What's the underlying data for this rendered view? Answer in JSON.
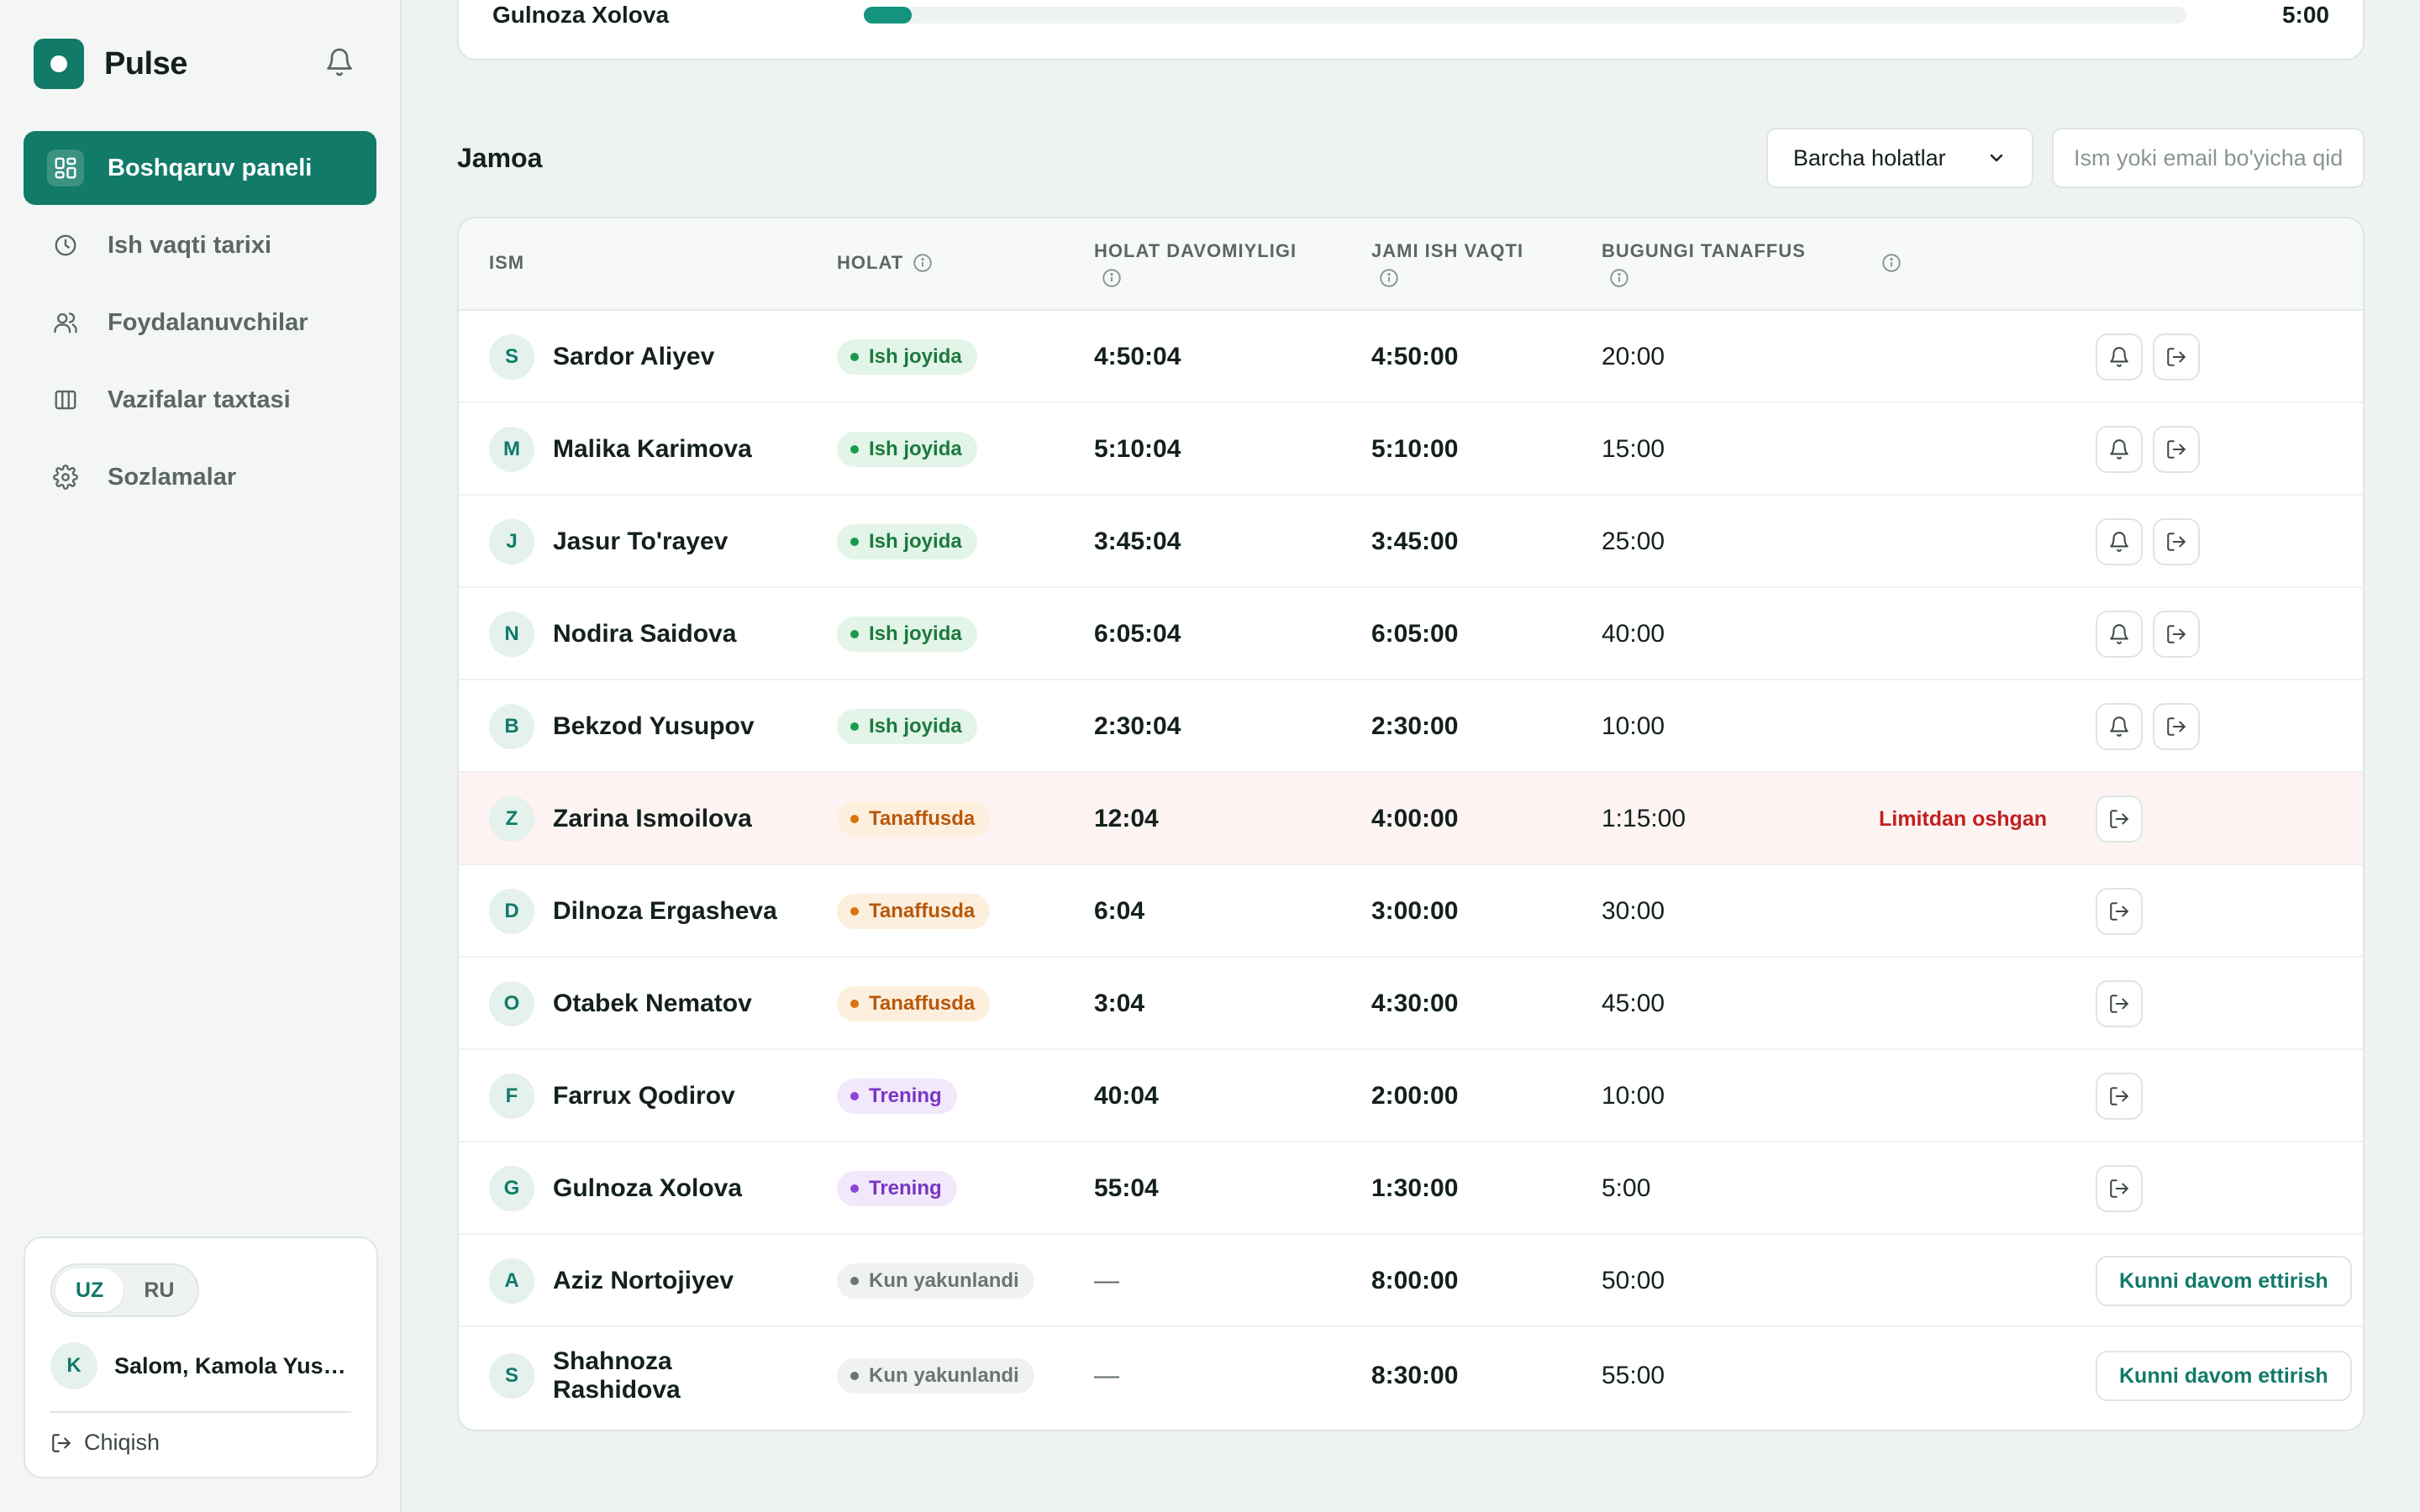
{
  "app": {
    "name": "Pulse",
    "brand_color": "#117a68"
  },
  "sidebar": {
    "items": [
      {
        "label": "Boshqaruv paneli",
        "icon": "dashboard-icon",
        "active": true
      },
      {
        "label": "Ish vaqti tarixi",
        "icon": "clock-icon",
        "active": false
      },
      {
        "label": "Foydalanuvchilar",
        "icon": "users-icon",
        "active": false
      },
      {
        "label": "Vazifalar taxtasi",
        "icon": "columns-icon",
        "active": false
      },
      {
        "label": "Sozlamalar",
        "icon": "gear-icon",
        "active": false
      }
    ]
  },
  "user_card": {
    "lang_uz": "UZ",
    "lang_ru": "RU",
    "active_lang": "UZ",
    "avatar_letter": "K",
    "greeting": "Salom, Kamola Yusu...",
    "logout_label": "Chiqish"
  },
  "top_strip": {
    "name": "Gulnoza Xolova",
    "time": "5:00",
    "progress_fraction": 0.036
  },
  "team": {
    "title": "Jamoa",
    "filter_selected": "Barcha holatlar",
    "search_placeholder": "Ism yoki email bo'yicha qidirish"
  },
  "table": {
    "headers": {
      "name": "ISM",
      "status": "HOLAT",
      "status_duration": "HOLAT DAVOMIYLIGI",
      "total_work": "JAMI ISH VAQTI",
      "break_today": "BUGUNGI TANAFFUS"
    },
    "resume_label": "Kunni davom ettirish",
    "rows": [
      {
        "initial": "S",
        "name": "Sardor Aliyev",
        "status": "Ish joyida",
        "tone": "green",
        "duration": "4:50:04",
        "total": "4:50:00",
        "break": "20:00",
        "warning": "",
        "actions": "bell-logout"
      },
      {
        "initial": "M",
        "name": "Malika Karimova",
        "status": "Ish joyida",
        "tone": "green",
        "duration": "5:10:04",
        "total": "5:10:00",
        "break": "15:00",
        "warning": "",
        "actions": "bell-logout"
      },
      {
        "initial": "J",
        "name": "Jasur To'rayev",
        "status": "Ish joyida",
        "tone": "green",
        "duration": "3:45:04",
        "total": "3:45:00",
        "break": "25:00",
        "warning": "",
        "actions": "bell-logout"
      },
      {
        "initial": "N",
        "name": "Nodira Saidova",
        "status": "Ish joyida",
        "tone": "green",
        "duration": "6:05:04",
        "total": "6:05:00",
        "break": "40:00",
        "warning": "",
        "actions": "bell-logout"
      },
      {
        "initial": "B",
        "name": "Bekzod Yusupov",
        "status": "Ish joyida",
        "tone": "green",
        "duration": "2:30:04",
        "total": "2:30:00",
        "break": "10:00",
        "warning": "",
        "actions": "bell-logout"
      },
      {
        "initial": "Z",
        "name": "Zarina Ismoilova",
        "status": "Tanaffusda",
        "tone": "orange",
        "duration": "12:04",
        "total": "4:00:00",
        "break": "1:15:00",
        "warning": "Limitdan oshgan",
        "actions": "logout"
      },
      {
        "initial": "D",
        "name": "Dilnoza Ergasheva",
        "status": "Tanaffusda",
        "tone": "orange",
        "duration": "6:04",
        "total": "3:00:00",
        "break": "30:00",
        "warning": "",
        "actions": "logout"
      },
      {
        "initial": "O",
        "name": "Otabek Nematov",
        "status": "Tanaffusda",
        "tone": "orange",
        "duration": "3:04",
        "total": "4:30:00",
        "break": "45:00",
        "warning": "",
        "actions": "logout"
      },
      {
        "initial": "F",
        "name": "Farrux Qodirov",
        "status": "Trening",
        "tone": "purple",
        "duration": "40:04",
        "total": "2:00:00",
        "break": "10:00",
        "warning": "",
        "actions": "logout"
      },
      {
        "initial": "G",
        "name": "Gulnoza Xolova",
        "status": "Trening",
        "tone": "purple",
        "duration": "55:04",
        "total": "1:30:00",
        "break": "5:00",
        "warning": "",
        "actions": "logout"
      },
      {
        "initial": "A",
        "name": "Aziz Nortojiyev",
        "status": "Kun yakunlandi",
        "tone": "gray",
        "duration": "—",
        "total": "8:00:00",
        "break": "50:00",
        "warning": "",
        "actions": "resume"
      },
      {
        "initial": "S",
        "name": "Shahnoza Rashidova",
        "status": "Kun yakunlandi",
        "tone": "gray",
        "duration": "—",
        "total": "8:30:00",
        "break": "55:00",
        "warning": "",
        "actions": "resume"
      }
    ]
  }
}
